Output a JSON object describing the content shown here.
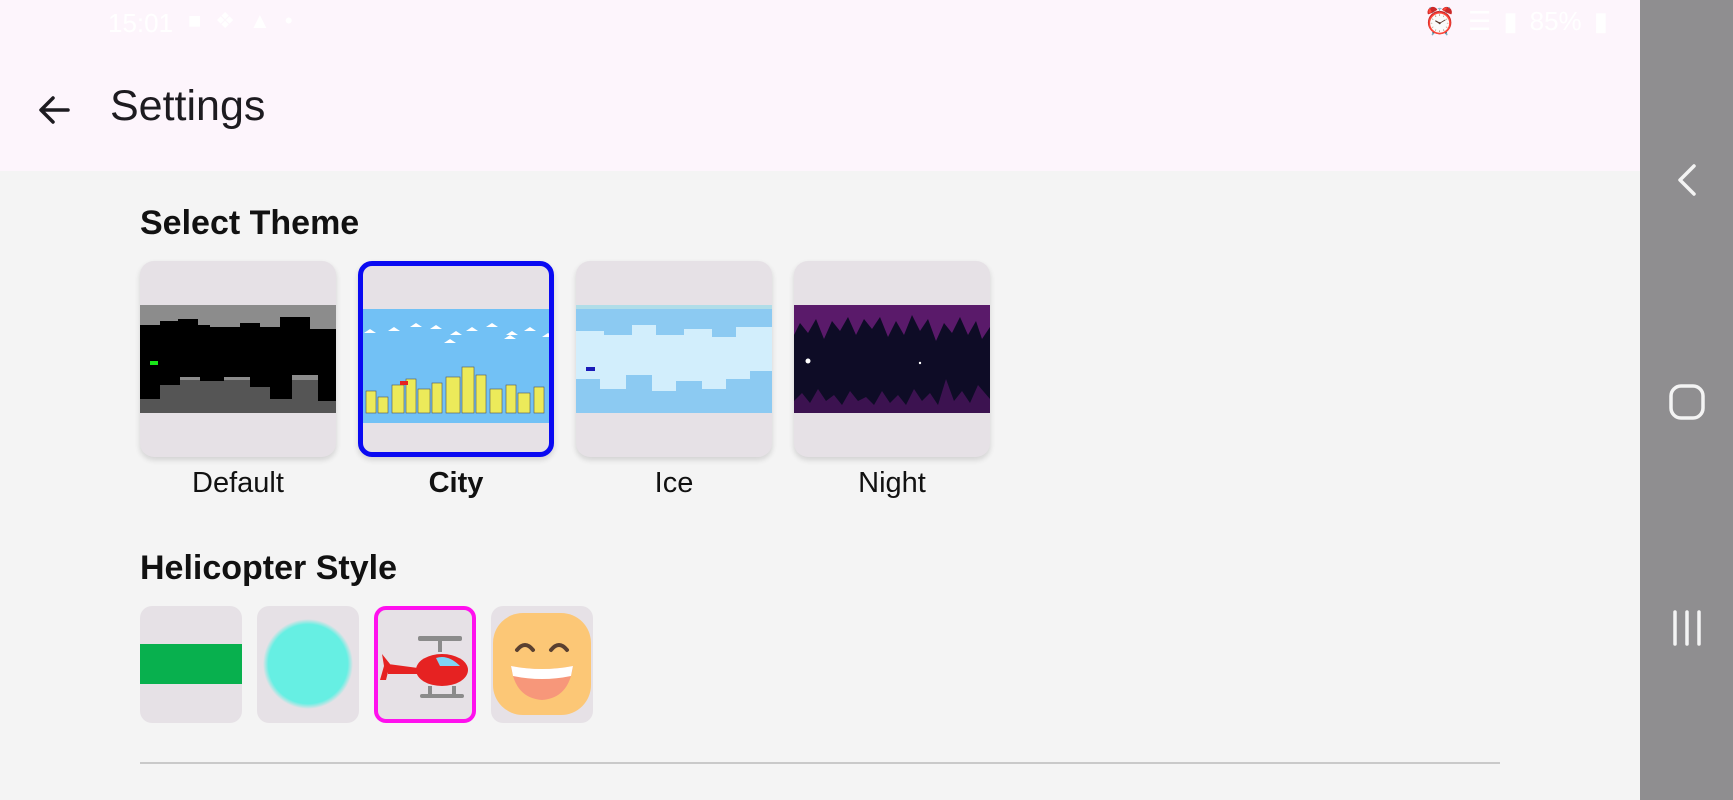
{
  "status_bar": {
    "time": "15:01",
    "battery": "85%",
    "left_icons": [
      "message-icon",
      "network-icon",
      "robot-icon",
      "dot-icon"
    ],
    "right_icons": [
      "alarm-icon",
      "wifi-icon",
      "signal-icon",
      "battery-icon"
    ]
  },
  "app_bar": {
    "title": "Settings",
    "back_icon": "arrow-back-icon"
  },
  "themes": {
    "heading": "Select Theme",
    "selected": "City",
    "accent": "#0a0af2",
    "items": [
      {
        "label": "Default"
      },
      {
        "label": "City"
      },
      {
        "label": "Ice"
      },
      {
        "label": "Night"
      }
    ]
  },
  "helicopter": {
    "heading": "Helicopter Style",
    "selected_index": 2,
    "accent": "#ff10ee",
    "items": [
      {
        "icon": "green-bar-icon"
      },
      {
        "icon": "teal-circle-icon"
      },
      {
        "icon": "helicopter-icon"
      },
      {
        "icon": "smiley-face-icon"
      }
    ]
  },
  "system_nav": {
    "back": "chevron-back-icon",
    "home": "home-square-icon",
    "recents": "recents-icon"
  }
}
